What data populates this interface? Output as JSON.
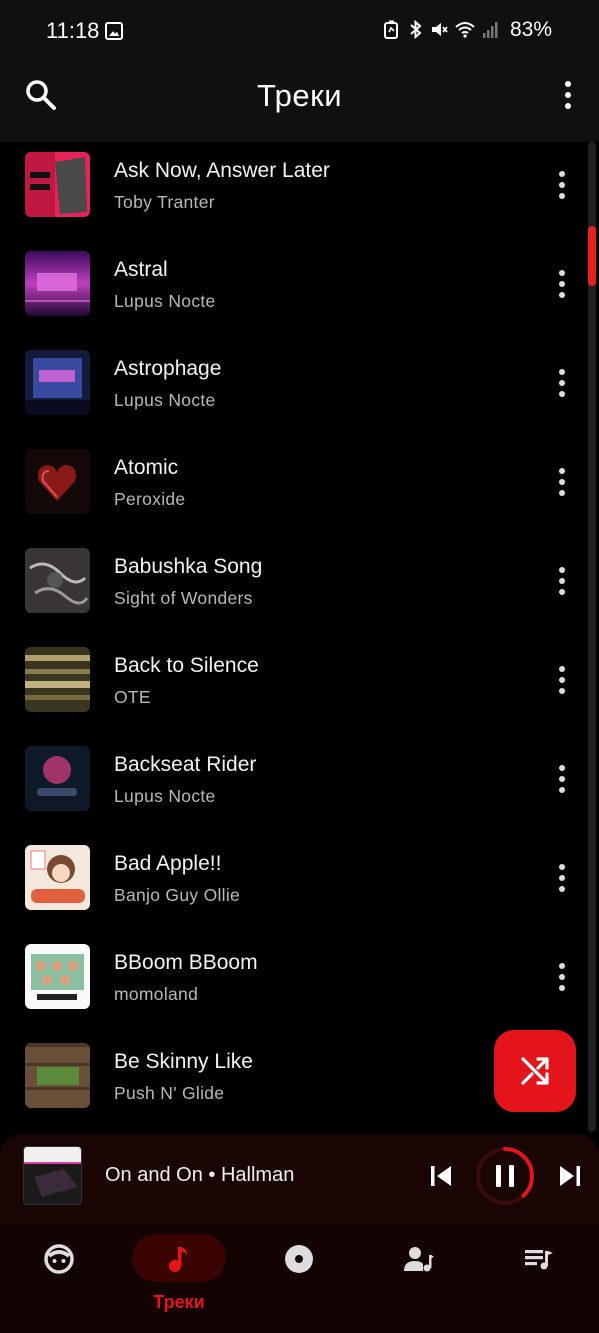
{
  "status_bar": {
    "time": "11:18",
    "battery": "83%",
    "icons": [
      "image-notification-icon",
      "battery-saver-icon",
      "bluetooth-icon",
      "mute-icon",
      "wifi-icon",
      "signal-icon"
    ]
  },
  "header": {
    "title": "Треки"
  },
  "tracks": [
    {
      "title": "Ask Now, Answer Later",
      "artist": "Toby Tranter"
    },
    {
      "title": "Astral",
      "artist": "Lupus Nocte"
    },
    {
      "title": "Astrophage",
      "artist": "Lupus Nocte"
    },
    {
      "title": "Atomic",
      "artist": "Peroxide"
    },
    {
      "title": "Babushka Song",
      "artist": "Sight of Wonders"
    },
    {
      "title": "Back to Silence",
      "artist": "OTE"
    },
    {
      "title": "Backseat Rider",
      "artist": "Lupus Nocte"
    },
    {
      "title": "Bad Apple!!",
      "artist": "Banjo Guy Ollie"
    },
    {
      "title": "BBoom BBoom",
      "artist": "momoland"
    },
    {
      "title": "Be Skinny Like",
      "artist": "Push N' Glide"
    }
  ],
  "now_playing": {
    "text": "On and On • Hallman",
    "progress": 0.38
  },
  "bottom_nav": {
    "items": [
      {
        "icon": "face-icon",
        "label": ""
      },
      {
        "icon": "music-note-icon",
        "label": "Треки"
      },
      {
        "icon": "album-icon",
        "label": ""
      },
      {
        "icon": "artist-icon",
        "label": ""
      },
      {
        "icon": "playlist-icon",
        "label": ""
      }
    ],
    "active_index": 1
  },
  "colors": {
    "accent": "#e3141a",
    "background": "#000000",
    "bar": "#101010"
  }
}
